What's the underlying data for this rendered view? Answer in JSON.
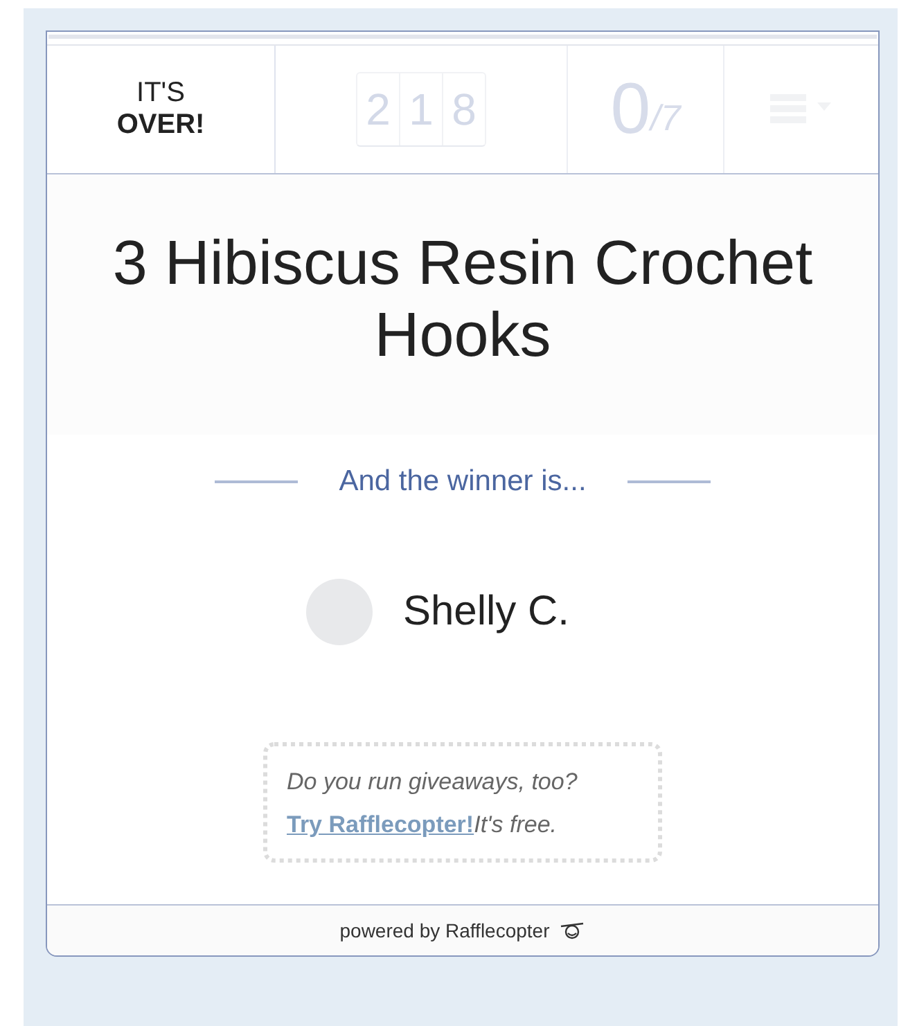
{
  "header": {
    "status_line1": "IT'S",
    "status_line2": "OVER!",
    "entry_digits": [
      "2",
      "1",
      "8"
    ],
    "my_entries": "0",
    "total_entries": "/7"
  },
  "title": "3 Hibiscus Resin Crochet Hooks",
  "winner_heading": "And the winner is...",
  "winner": {
    "name": "Shelly C."
  },
  "promo": {
    "question": "Do you run giveaways, too?",
    "link": "Try Rafflecopter!",
    "note": "It's free."
  },
  "footer": "powered by Rafflecopter"
}
